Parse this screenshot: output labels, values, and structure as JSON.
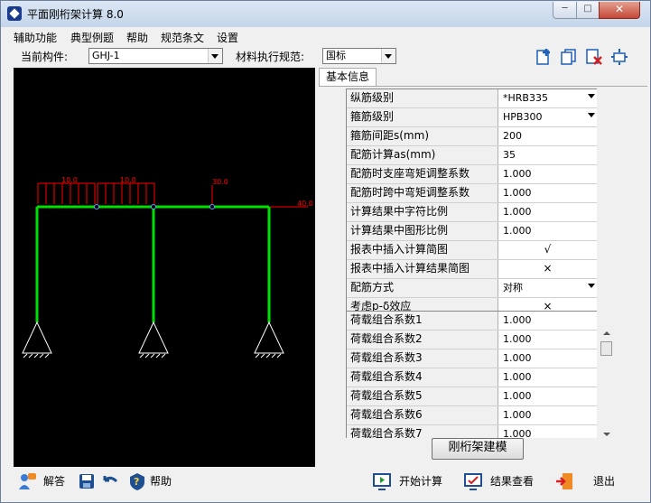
{
  "window": {
    "title": "平面刚桁架计算 8.0",
    "min": "─",
    "max": "□",
    "close": "✕"
  },
  "menu": [
    "辅助功能",
    "典型例题",
    "帮助",
    "规范条文",
    "设置"
  ],
  "toolbar": {
    "component_label": "当前构件:",
    "component_value": "GHJ-1",
    "material_label": "材料执行规范:",
    "material_value": "国标"
  },
  "tab": "基本信息",
  "properties": [
    {
      "key": "纵筋级别",
      "value": "*HRB335",
      "dropdown": true
    },
    {
      "key": "箍筋级别",
      "value": "HPB300",
      "dropdown": true
    },
    {
      "key": "箍筋间距s(mm)",
      "value": "200"
    },
    {
      "key": "配筋计算as(mm)",
      "value": "35"
    },
    {
      "key": "配筋时支座弯矩调整系数",
      "value": "1.000"
    },
    {
      "key": "配筋时跨中弯矩调整系数",
      "value": "1.000"
    },
    {
      "key": "计算结果中字符比例",
      "value": "1.000"
    },
    {
      "key": "计算结果中图形比例",
      "value": "1.000"
    },
    {
      "key": "报表中插入计算简图",
      "value": "√",
      "center": true
    },
    {
      "key": "报表中插入计算结果简图",
      "value": "×",
      "center": true
    },
    {
      "key": "配筋方式",
      "value": "对称",
      "dropdown": true
    },
    {
      "key": "考虑p-δ效应",
      "value": "×",
      "center": true
    }
  ],
  "load_factors": [
    {
      "key": "荷载组合系数1",
      "value": "1.000"
    },
    {
      "key": "荷载组合系数2",
      "value": "1.000"
    },
    {
      "key": "荷载组合系数3",
      "value": "1.000"
    },
    {
      "key": "荷载组合系数4",
      "value": "1.000"
    },
    {
      "key": "荷载组合系数5",
      "value": "1.000"
    },
    {
      "key": "荷载组合系数6",
      "value": "1.000"
    },
    {
      "key": "荷载组合系数7",
      "value": "1.000"
    }
  ],
  "model_button": "刚桁架建模",
  "canvas_labels": {
    "load1": "10.0",
    "load2": "10.0",
    "point1": "30.0",
    "point2": "40.0"
  },
  "bottom": {
    "answer": "解答",
    "help": "帮助",
    "start": "开始计算",
    "results": "结果查看",
    "exit": "退出"
  },
  "colors": {
    "frame": "#00e000",
    "load": "#ff0000",
    "support": "#ffffff"
  }
}
